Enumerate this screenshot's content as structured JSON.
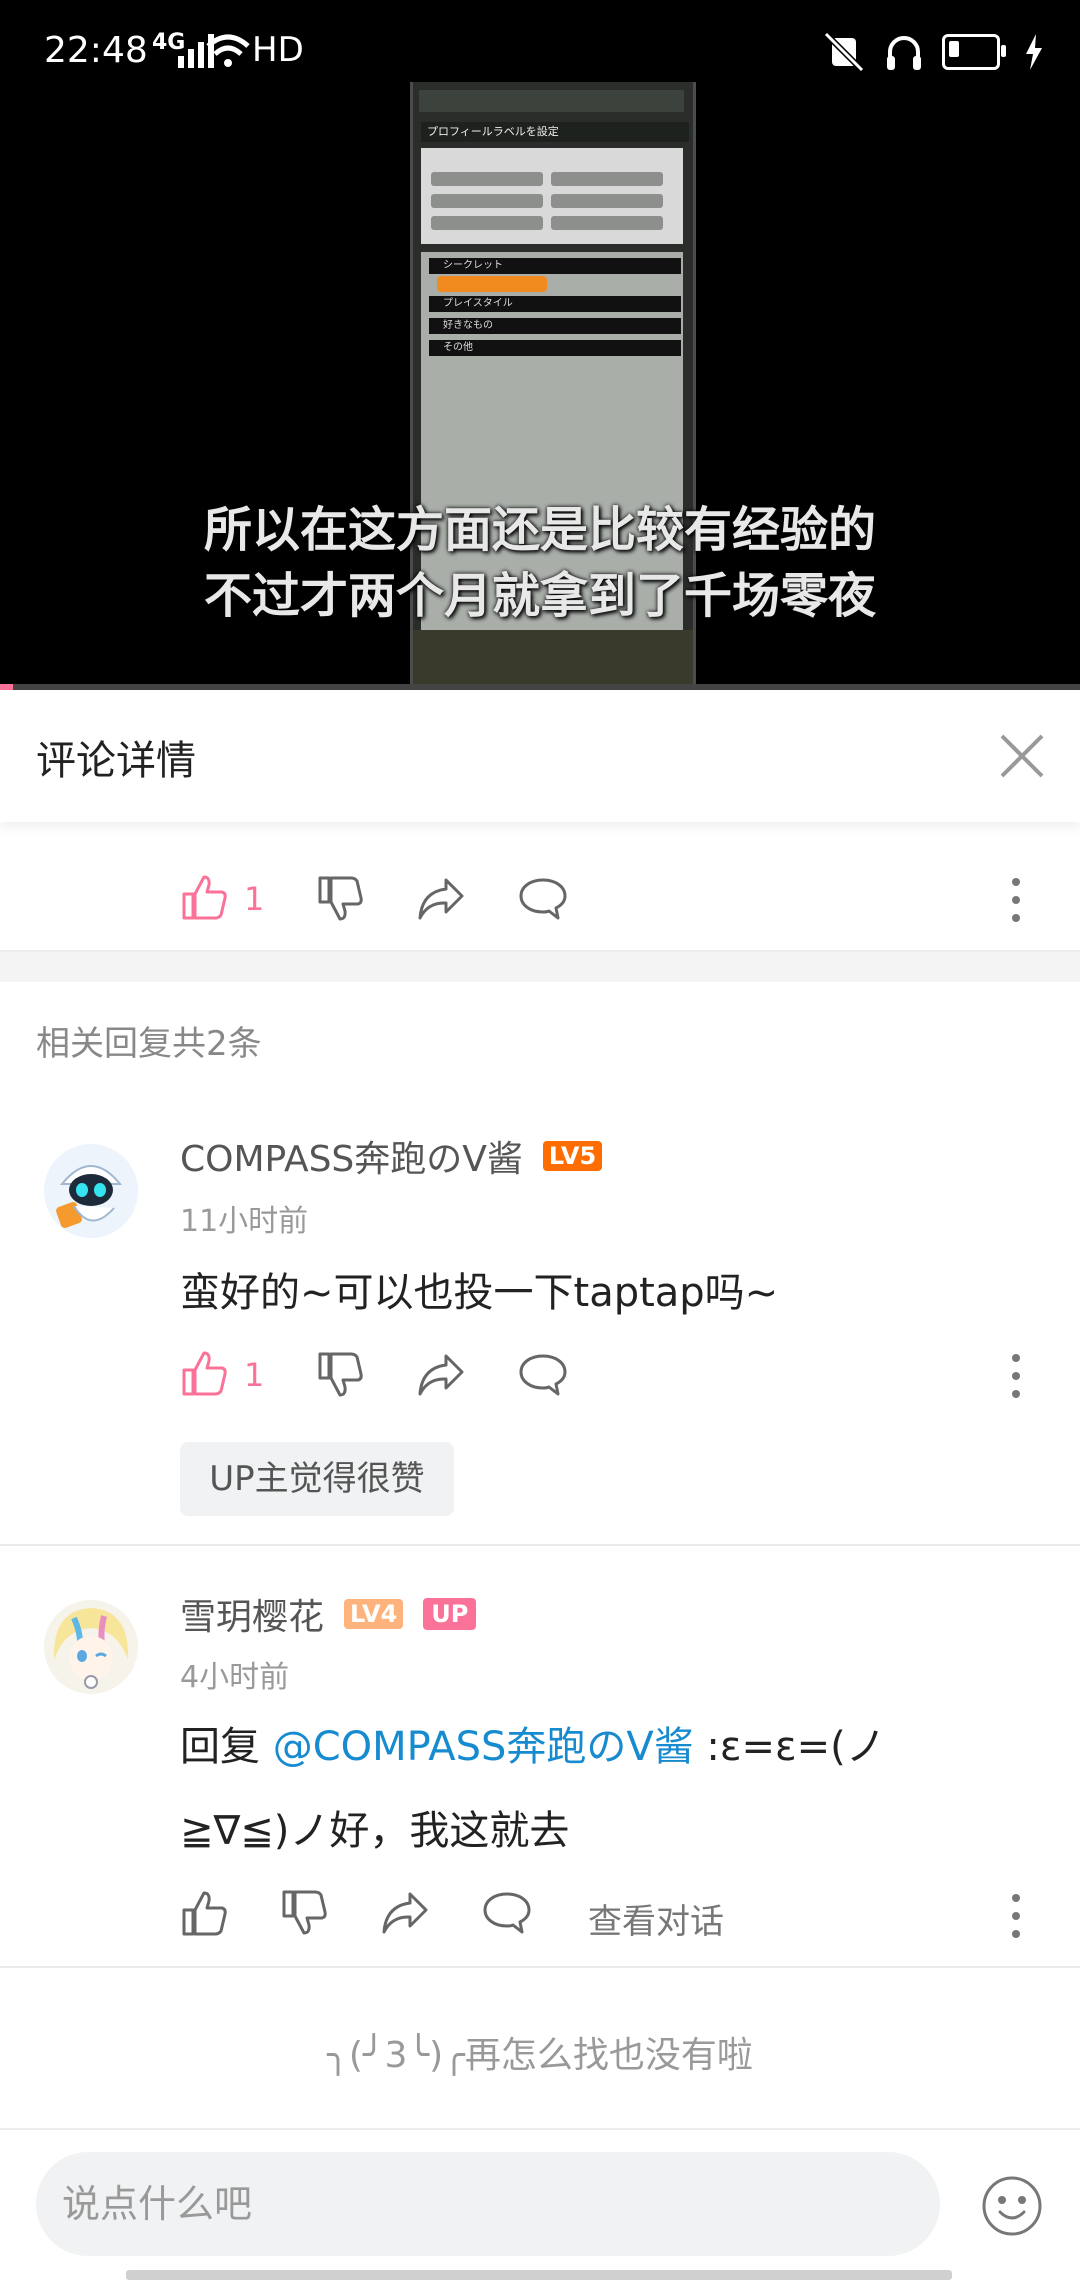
{
  "status_bar": {
    "time": "22:48",
    "network": "4G",
    "hd": "HD"
  },
  "video": {
    "subtitle_line1": "所以在这方面还是比较有经验的",
    "subtitle_line2": "不过才两个月就拿到了千场零夜",
    "game_title": "プロフィールラベルを設定",
    "game_rows": [
      "シークレット",
      "プレイスタイル",
      "好きなもの",
      "その他"
    ],
    "progress": 0.012
  },
  "header": {
    "title": "评论详情"
  },
  "top_comment": {
    "like_count": "1"
  },
  "replies_section": {
    "count_label": "相关回复共2条"
  },
  "replies": [
    {
      "username": "COMPASS奔跑のV酱",
      "level": "LV5",
      "time": "11小时前",
      "text": "蛮好的~可以也投一下taptap吗~",
      "like_count": "1",
      "up_liked_label": "UP主觉得很赞"
    },
    {
      "username": "雪玥樱花",
      "level": "LV4",
      "up_badge": "UP",
      "time": "4小时前",
      "reply_prefix": "回复 ",
      "mention": "@COMPASS奔跑のV酱",
      "text_line1_rest": " :ε=ε=(ノ",
      "text_line2": "≧∇≦)ノ好，我这就去",
      "view_conversation": "查看对话"
    }
  ],
  "end_message": "╮(╯3╰)╭再怎么找也没有啦",
  "input": {
    "placeholder": "说点什么吧"
  },
  "colors": {
    "accent": "#fb7299",
    "link": "#178bcf",
    "lv5": "#ff6c00",
    "lv4": "#ffb37c"
  }
}
